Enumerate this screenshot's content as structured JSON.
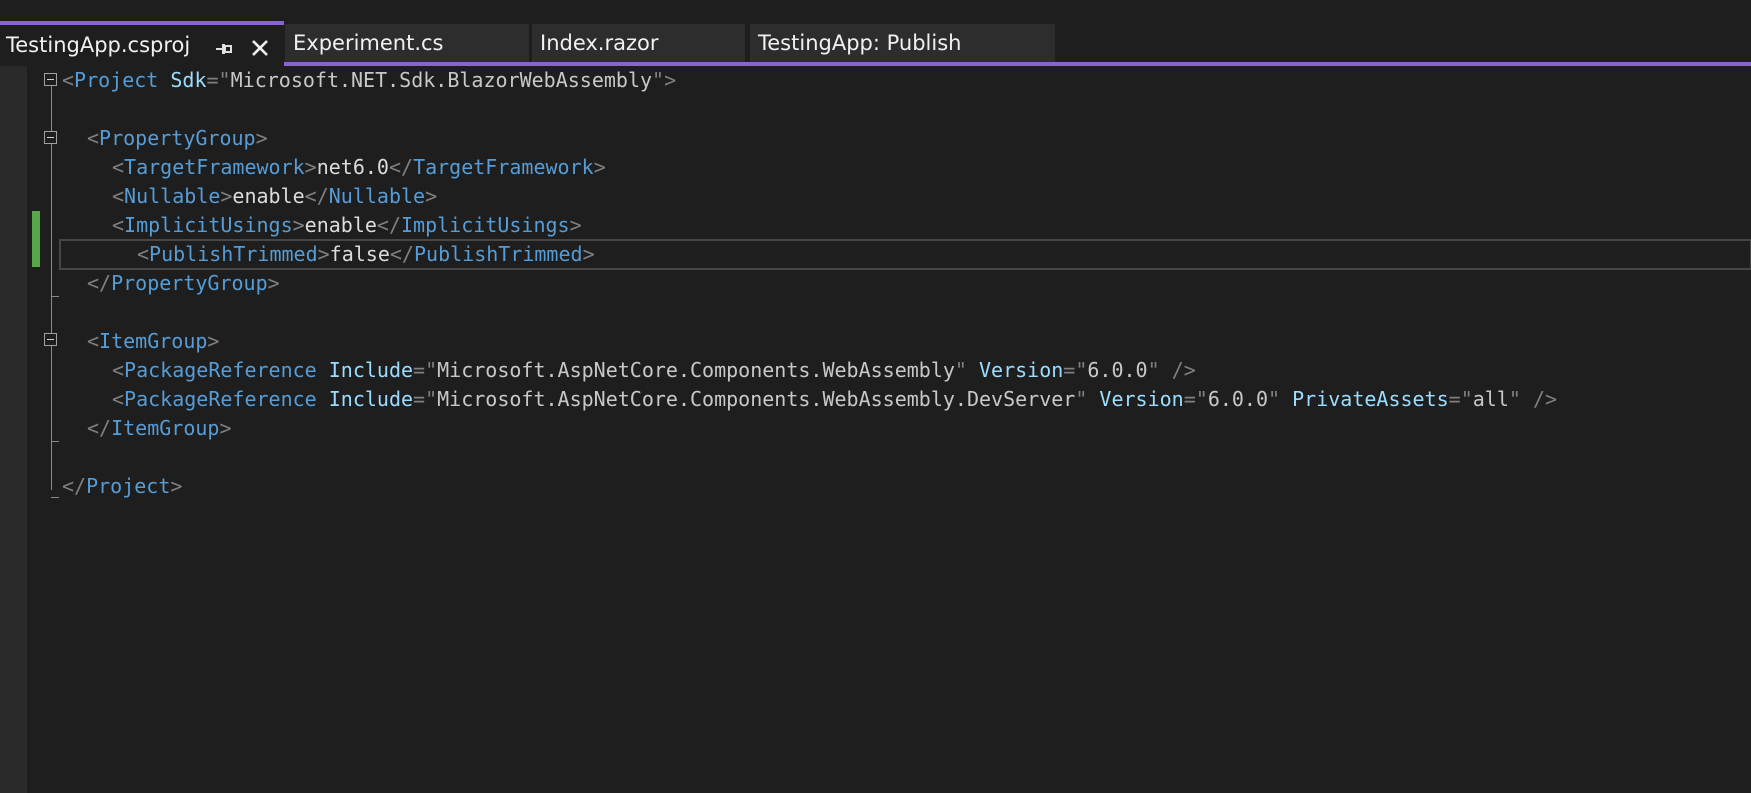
{
  "tabs": [
    {
      "label": "TestingApp.csproj",
      "active": true,
      "pinned": true
    },
    {
      "label": "Experiment.cs",
      "active": false
    },
    {
      "label": "Index.razor",
      "active": false
    },
    {
      "label": "TestingApp: Publish",
      "active": false
    }
  ],
  "icons": {
    "pin": "pin-icon",
    "close": "close-icon",
    "fold": "collapse-icon"
  },
  "colors": {
    "accent": "#8a63d2",
    "tag": "#569cd6",
    "attribute": "#9cdcfe",
    "punctuation": "#808080",
    "text": "#dcdcdc",
    "change_marker": "#57a64a",
    "background": "#1e1e1e"
  },
  "editor": {
    "lines": [
      {
        "indent": 0,
        "tokens": [
          {
            "c": "p",
            "v": "<"
          },
          {
            "c": "t",
            "v": "Project"
          },
          {
            "c": "x",
            "v": " "
          },
          {
            "c": "a",
            "v": "Sdk"
          },
          {
            "c": "p",
            "v": "=\""
          },
          {
            "c": "s",
            "v": "Microsoft.NET.Sdk.BlazorWebAssembly"
          },
          {
            "c": "p",
            "v": "\">"
          }
        ]
      },
      {
        "indent": 0,
        "tokens": []
      },
      {
        "indent": 1,
        "tokens": [
          {
            "c": "p",
            "v": "<"
          },
          {
            "c": "t",
            "v": "PropertyGroup"
          },
          {
            "c": "p",
            "v": ">"
          }
        ]
      },
      {
        "indent": 2,
        "tokens": [
          {
            "c": "p",
            "v": "<"
          },
          {
            "c": "t",
            "v": "TargetFramework"
          },
          {
            "c": "p",
            "v": ">"
          },
          {
            "c": "x",
            "v": "net6.0"
          },
          {
            "c": "p",
            "v": "</"
          },
          {
            "c": "t",
            "v": "TargetFramework"
          },
          {
            "c": "p",
            "v": ">"
          }
        ]
      },
      {
        "indent": 2,
        "tokens": [
          {
            "c": "p",
            "v": "<"
          },
          {
            "c": "t",
            "v": "Nullable"
          },
          {
            "c": "p",
            "v": ">"
          },
          {
            "c": "x",
            "v": "enable"
          },
          {
            "c": "p",
            "v": "</"
          },
          {
            "c": "t",
            "v": "Nullable"
          },
          {
            "c": "p",
            "v": ">"
          }
        ]
      },
      {
        "indent": 2,
        "tokens": [
          {
            "c": "p",
            "v": "<"
          },
          {
            "c": "t",
            "v": "ImplicitUsings"
          },
          {
            "c": "p",
            "v": ">"
          },
          {
            "c": "x",
            "v": "enable"
          },
          {
            "c": "p",
            "v": "</"
          },
          {
            "c": "t",
            "v": "ImplicitUsings"
          },
          {
            "c": "p",
            "v": ">"
          }
        ]
      },
      {
        "indent": 3,
        "current": true,
        "tokens": [
          {
            "c": "p",
            "v": "<"
          },
          {
            "c": "t",
            "v": "PublishTrimmed"
          },
          {
            "c": "p",
            "v": ">"
          },
          {
            "c": "x",
            "v": "false"
          },
          {
            "c": "p",
            "v": "</"
          },
          {
            "c": "t",
            "v": "PublishTrimmed"
          },
          {
            "c": "p",
            "v": ">"
          }
        ]
      },
      {
        "indent": 1,
        "tokens": [
          {
            "c": "p",
            "v": "</"
          },
          {
            "c": "t",
            "v": "PropertyGroup"
          },
          {
            "c": "p",
            "v": ">"
          }
        ]
      },
      {
        "indent": 0,
        "tokens": []
      },
      {
        "indent": 1,
        "tokens": [
          {
            "c": "p",
            "v": "<"
          },
          {
            "c": "t",
            "v": "ItemGroup"
          },
          {
            "c": "p",
            "v": ">"
          }
        ]
      },
      {
        "indent": 2,
        "tokens": [
          {
            "c": "p",
            "v": "<"
          },
          {
            "c": "t",
            "v": "PackageReference"
          },
          {
            "c": "x",
            "v": " "
          },
          {
            "c": "a",
            "v": "Include"
          },
          {
            "c": "p",
            "v": "=\""
          },
          {
            "c": "s",
            "v": "Microsoft.AspNetCore.Components.WebAssembly"
          },
          {
            "c": "p",
            "v": "\""
          },
          {
            "c": "x",
            "v": " "
          },
          {
            "c": "a",
            "v": "Version"
          },
          {
            "c": "p",
            "v": "=\""
          },
          {
            "c": "s",
            "v": "6.0.0"
          },
          {
            "c": "p",
            "v": "\" />"
          }
        ]
      },
      {
        "indent": 2,
        "tokens": [
          {
            "c": "p",
            "v": "<"
          },
          {
            "c": "t",
            "v": "PackageReference"
          },
          {
            "c": "x",
            "v": " "
          },
          {
            "c": "a",
            "v": "Include"
          },
          {
            "c": "p",
            "v": "=\""
          },
          {
            "c": "s",
            "v": "Microsoft.AspNetCore.Components.WebAssembly.DevServer"
          },
          {
            "c": "p",
            "v": "\""
          },
          {
            "c": "x",
            "v": " "
          },
          {
            "c": "a",
            "v": "Version"
          },
          {
            "c": "p",
            "v": "=\""
          },
          {
            "c": "s",
            "v": "6.0.0"
          },
          {
            "c": "p",
            "v": "\""
          },
          {
            "c": "x",
            "v": " "
          },
          {
            "c": "a",
            "v": "PrivateAssets"
          },
          {
            "c": "p",
            "v": "=\""
          },
          {
            "c": "s",
            "v": "all"
          },
          {
            "c": "p",
            "v": "\" />"
          }
        ]
      },
      {
        "indent": 1,
        "tokens": [
          {
            "c": "p",
            "v": "</"
          },
          {
            "c": "t",
            "v": "ItemGroup"
          },
          {
            "c": "p",
            "v": ">"
          }
        ]
      },
      {
        "indent": 0,
        "tokens": []
      },
      {
        "indent": 0,
        "tokens": [
          {
            "c": "p",
            "v": "</"
          },
          {
            "c": "t",
            "v": "Project"
          },
          {
            "c": "p",
            "v": ">"
          }
        ]
      }
    ]
  }
}
